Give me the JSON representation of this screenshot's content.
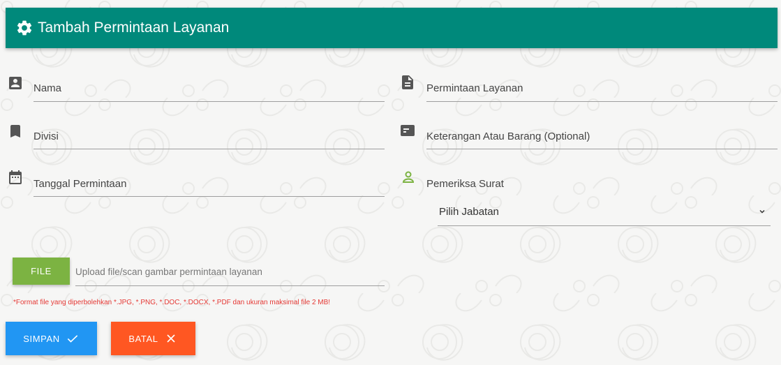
{
  "header": {
    "title": "Tambah Permintaan Layanan",
    "icon": "gear-icon"
  },
  "form": {
    "nama": {
      "label": "Nama",
      "icon": "contact-card-icon"
    },
    "divisi": {
      "label": "Divisi",
      "icon": "bookmark-icon"
    },
    "tanggal": {
      "label": "Tanggal Permintaan",
      "icon": "calendar-icon"
    },
    "permintaan": {
      "label": "Permintaan Layanan",
      "icon": "document-icon"
    },
    "keterangan": {
      "label": "Keterangan Atau Barang (Optional)",
      "icon": "card-icon"
    },
    "pemeriksa": {
      "label": "Pemeriksa Surat",
      "icon": "person-icon",
      "icon_color": "#7cb342"
    },
    "jabatan_select": {
      "value": "Pilih Jabatan"
    }
  },
  "upload": {
    "button_label": "FILE",
    "placeholder": "Upload file/scan gambar permintaan layanan",
    "note": "*Format file yang diperbolehkan *.JPG, *.PNG, *.DOC, *.DOCX, *.PDF dan ukuran maksimal file 2 MB!"
  },
  "actions": {
    "save_label": "SIMPAN",
    "cancel_label": "BATAL"
  },
  "colors": {
    "header": "#00897b",
    "file_button": "#7cb342",
    "save_button": "#2196f3",
    "cancel_button": "#ff5722",
    "note_text": "#e53935"
  }
}
